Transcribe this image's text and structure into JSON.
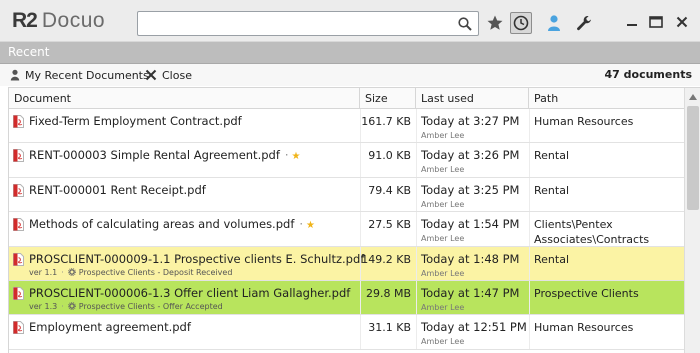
{
  "app": {
    "logo_r2": "R2",
    "logo_name": "Docuo"
  },
  "search": {
    "value": "",
    "placeholder": ""
  },
  "header": {
    "section_title": "Recent"
  },
  "toolbar": {
    "my_recent_label": "My Recent Documents",
    "close_label": "Close",
    "doc_count": "47 documents"
  },
  "table": {
    "columns": [
      "Document",
      "Size",
      "Last used",
      "Path"
    ],
    "rows": [
      {
        "name": "Fixed-Term Employment Contract.pdf",
        "size": "161.7 KB",
        "last_used": "Today at 3:27 PM",
        "user": "Amber Lee",
        "path": "Human Resources",
        "starred": false,
        "highlight": "none",
        "version": "",
        "workflow": ""
      },
      {
        "name": "RENT-000003 Simple Rental Agreement.pdf",
        "size": "91.0 KB",
        "last_used": "Today at 3:26 PM",
        "user": "Amber Lee",
        "path": "Rental",
        "starred": true,
        "highlight": "none",
        "version": "",
        "workflow": ""
      },
      {
        "name": "RENT-000001 Rent Receipt.pdf",
        "size": "79.4 KB",
        "last_used": "Today at 3:25 PM",
        "user": "Amber Lee",
        "path": "Rental",
        "starred": false,
        "highlight": "none",
        "version": "",
        "workflow": ""
      },
      {
        "name": "Methods of calculating areas and volumes.pdf",
        "size": "27.5 KB",
        "last_used": "Today at 1:54 PM",
        "user": "Amber Lee",
        "path": "Clients\\Pentex Associates\\Contracts",
        "starred": true,
        "highlight": "none",
        "version": "",
        "workflow": ""
      },
      {
        "name": "PROSCLIENT-000009-1.1 Prospective clients E. Schultz.pdf",
        "size": "149.2 KB",
        "last_used": "Today at 1:48 PM",
        "user": "Amber Lee",
        "path": "Rental",
        "starred": false,
        "highlight": "yellow",
        "version": "ver 1.1",
        "workflow": "Prospective Clients - Deposit Received"
      },
      {
        "name": "PROSCLIENT-000006-1.3 Offer client Liam Gallagher.pdf",
        "size": "29.8 MB",
        "last_used": "Today at 1:47 PM",
        "user": "Amber Lee",
        "path": "Prospective Clients",
        "starred": false,
        "highlight": "green",
        "version": "ver 1.3",
        "workflow": "Prospective Clients - Offer Accepted"
      },
      {
        "name": "Employment agreement.pdf",
        "size": "31.1 KB",
        "last_used": "Today at 12:51 PM",
        "user": "Amber Lee",
        "path": "Human Resources",
        "starred": false,
        "highlight": "none",
        "version": "",
        "workflow": ""
      }
    ]
  },
  "colors": {
    "yellow_row": "#fbf3a4",
    "green_row": "#b8e45d",
    "star": "#f0b419",
    "pdf_red": "#d22b2b",
    "recent_bar": "#bdbdbd"
  },
  "icons": [
    "search-icon",
    "star-icon",
    "clock-icon",
    "user-icon",
    "wrench-icon",
    "minimize-icon",
    "maximize-icon",
    "close-icon",
    "pdf-icon",
    "gear-icon"
  ]
}
